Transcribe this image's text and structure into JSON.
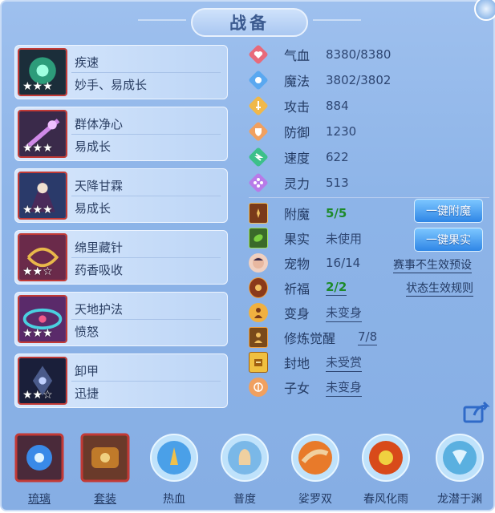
{
  "title": "战备",
  "skills": [
    {
      "name": "疾速",
      "desc": "妙手、易成长",
      "stars": "★★★",
      "art_color": "#2d9c7a"
    },
    {
      "name": "群体净心",
      "desc": "易成长",
      "stars": "★★★",
      "art_color": "#8a4a9c"
    },
    {
      "name": "天降甘霖",
      "desc": "易成长",
      "stars": "★★★",
      "art_color": "#3a3f7a"
    },
    {
      "name": "绵里藏针",
      "desc": "药香吸收",
      "stars": "★★☆",
      "art_color": "#7a4a2a"
    },
    {
      "name": "天地护法",
      "desc": "愤怒",
      "stars": "★★★",
      "art_color": "#3a8a9c"
    },
    {
      "name": "卸甲",
      "desc": "迅捷",
      "stars": "★★☆",
      "art_color": "#2a2f4a"
    }
  ],
  "stats": {
    "hp": {
      "label": "气血",
      "value": "8380/8380",
      "icon": "heart-icon",
      "color": "#e86a7a"
    },
    "mp": {
      "label": "魔法",
      "value": "3802/3802",
      "icon": "magic-icon",
      "color": "#5aa8f0"
    },
    "atk": {
      "label": "攻击",
      "value": "884",
      "icon": "sword-icon",
      "color": "#f0b84a"
    },
    "def": {
      "label": "防御",
      "value": "1230",
      "icon": "shield-icon",
      "color": "#f0a060"
    },
    "spd": {
      "label": "速度",
      "value": "622",
      "icon": "speed-icon",
      "color": "#3cc08a"
    },
    "spi": {
      "label": "灵力",
      "value": "513",
      "icon": "spirit-icon",
      "color": "#b87ae8"
    },
    "enchant": {
      "label": "附魔",
      "value": "5/5"
    },
    "fruit": {
      "label": "果实",
      "value": "未使用"
    },
    "pet": {
      "label": "宠物",
      "value": "16/14"
    },
    "bless": {
      "label": "祈福",
      "value": "2/2"
    },
    "transform": {
      "label": "变身",
      "value": "未变身"
    },
    "cultivate": {
      "label": "修炼觉醒",
      "value": "7/8"
    },
    "fief": {
      "label": "封地",
      "value": "未受赏"
    },
    "child": {
      "label": "子女",
      "value": "未变身"
    }
  },
  "buttons": {
    "enchant": "一键附魔",
    "fruit": "一键果实"
  },
  "links": {
    "event_preset": "赛事不生效预设",
    "state_rules": "状态生效规则"
  },
  "bottom": [
    {
      "label": "琉璃",
      "type": "square",
      "color": "#3a8ae8"
    },
    {
      "label": "套装",
      "type": "square",
      "color": "#c07a2a"
    },
    {
      "label": "热血",
      "type": "round",
      "color": "#f0c04a"
    },
    {
      "label": "普度",
      "type": "round",
      "color": "#f0d0a0"
    },
    {
      "label": "娑罗双",
      "type": "round",
      "color": "#f0a040"
    },
    {
      "label": "春风化雨",
      "type": "round",
      "color": "#f07a2a"
    },
    {
      "label": "龙潜于渊",
      "type": "round",
      "color": "#8ad0f0"
    }
  ]
}
